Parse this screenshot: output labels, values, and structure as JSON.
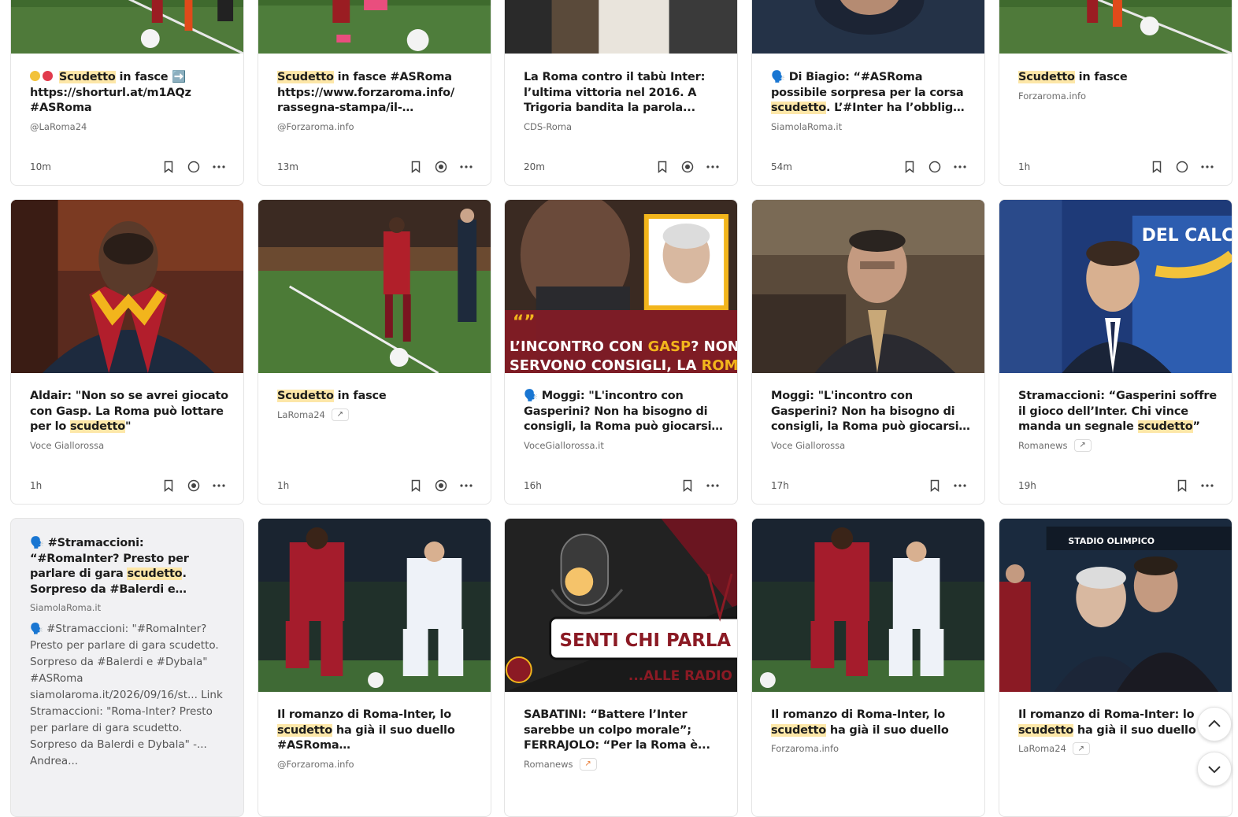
{
  "colors": {
    "highlight": "#fde7a8",
    "trend_hot": "#e8772e",
    "roma_red": "#8b1a24",
    "gold": "#f2b51c"
  },
  "rows": [
    [
      {
        "title_pre": "",
        "title_hl": "Scudetto",
        "title_post": " in fasce ➡️ https://shorturl.at/m1AQz #ASRoma",
        "emoji": "circles",
        "source": "@LaRoma24",
        "time": "10m",
        "actions": [
          "bookmark",
          "circle",
          "more"
        ]
      },
      {
        "title_pre": "",
        "title_hl": "Scudetto",
        "title_post": " in fasce #ASRoma https://www.forzaroma.info/ rassegna-stampa/il-messagger...",
        "source": "@Forzaroma.info",
        "time": "13m",
        "actions": [
          "bookmark",
          "radio",
          "more"
        ]
      },
      {
        "title_pre": "La Roma contro il tabù Inter: l’ultima vittoria nel 2016. A Trigoria bandita la parola...",
        "title_hl": "",
        "title_post": "",
        "source": "CDS-Roma",
        "time": "20m",
        "actions": [
          "bookmark",
          "radio",
          "more"
        ]
      },
      {
        "title_pre": "🗣️ Di Biagio: “#ASRoma possibile sorpresa per la corsa ",
        "title_hl": "scudetto",
        "title_post": ". L’#Inter ha l’obbligo di vincere, i...",
        "source": "SiamolaRoma.it",
        "time": "54m",
        "actions": [
          "bookmark",
          "circle",
          "more"
        ]
      },
      {
        "title_pre": "",
        "title_hl": "Scudetto",
        "title_post": " in fasce",
        "source": "Forzaroma.info",
        "time": "1h",
        "actions": [
          "bookmark",
          "circle",
          "more"
        ]
      }
    ],
    [
      {
        "title_pre": "Aldair: \"Non so se avrei giocato con Gasp. La Roma può lottare per lo ",
        "title_hl": "scudetto",
        "title_post": "\"",
        "source": "Voce Giallorossa",
        "time": "1h",
        "actions": [
          "bookmark",
          "radio",
          "more"
        ]
      },
      {
        "title_pre": "",
        "title_hl": "Scudetto",
        "title_post": " in fasce",
        "source": "LaRoma24",
        "trend": "↗",
        "time": "1h",
        "actions": [
          "bookmark",
          "radio",
          "more"
        ]
      },
      {
        "title_pre": "🗣️ Moggi: \"L'incontro con Gasperini? Non ha bisogno di consigli, la Roma può giocarsi lo...",
        "title_hl": "",
        "title_post": "",
        "source": "VoceGiallorossa.it",
        "time": "16h",
        "actions": [
          "bookmark",
          "more"
        ],
        "overlay": {
          "quote": "“”",
          "line1_a": "L’INCONTRO CON ",
          "line1_b": "GASP",
          "line1_c": "? NON GLI",
          "line2_a": "SERVONO CONSIGLI, LA ",
          "line2_b": "ROMA"
        }
      },
      {
        "title_pre": "Moggi: \"L'incontro con Gasperini? Non ha bisogno di consigli, la Roma può giocarsi lo ",
        "title_hl": "scudetto",
        "title_post": "\"",
        "source": "Voce Giallorossa",
        "time": "17h",
        "actions": [
          "bookmark",
          "more"
        ]
      },
      {
        "title_pre": "Stramaccioni: “Gasperini soffre il gioco dell’Inter. Chi vince manda un segnale ",
        "title_hl": "scudetto",
        "title_post": "”",
        "source": "Romanews",
        "trend": "↗",
        "time": "19h",
        "actions": [
          "bookmark",
          "more"
        ],
        "overlay": {
          "banner": "DEL CALCIO"
        }
      }
    ],
    [
      {
        "title_pre": "🗣️ #Stramaccioni: “#RomaInter? Presto per parlare di gara ",
        "title_hl": "scudetto",
        "title_post": ". Sorpreso da #Balerdi e #Dybala” #ASRoma https://ww...",
        "source": "SiamolaRoma.it",
        "snippet": "🗣️ #Stramaccioni: \"#RomaInter? Presto per parlare di gara scudetto. Sorpreso da #Balerdi e #Dybala\" #ASRoma siamolaroma.it/2026/09/16/st... Link Stramaccioni: \"Roma-Inter? Presto per parlare di gara scudetto. Sorpreso da Balerdi e Dybala\" -... Andrea..."
      },
      {
        "title_pre": "Il romanzo di Roma-Inter, lo ",
        "title_hl": "scudetto",
        "title_post": " ha già il suo duello #ASRoma https://www.forzaro...",
        "source": "@Forzaroma.info"
      },
      {
        "title_pre": "SABATINI: “Battere l’Inter sarebbe un colpo morale”; FERRAJOLO: “Per la Roma è...",
        "title_hl": "",
        "title_post": "",
        "source": "Romanews",
        "trend": "↗",
        "trend_hot": true,
        "overlay": {
          "line1": "SENTI CHI PARLA",
          "line2": "...ALLE RADIO"
        }
      },
      {
        "title_pre": "Il romanzo di Roma-Inter, lo ",
        "title_hl": "scudetto",
        "title_post": " ha già il suo duello",
        "source": "Forzaroma.info"
      },
      {
        "title_pre": "Il romanzo di Roma-Inter: lo ",
        "title_hl": "scudetto",
        "title_post": " ha già il suo duello",
        "source": "LaRoma24",
        "trend": "↗",
        "overlay": {
          "stadium": "STADIO OLIMPICO"
        }
      }
    ]
  ]
}
